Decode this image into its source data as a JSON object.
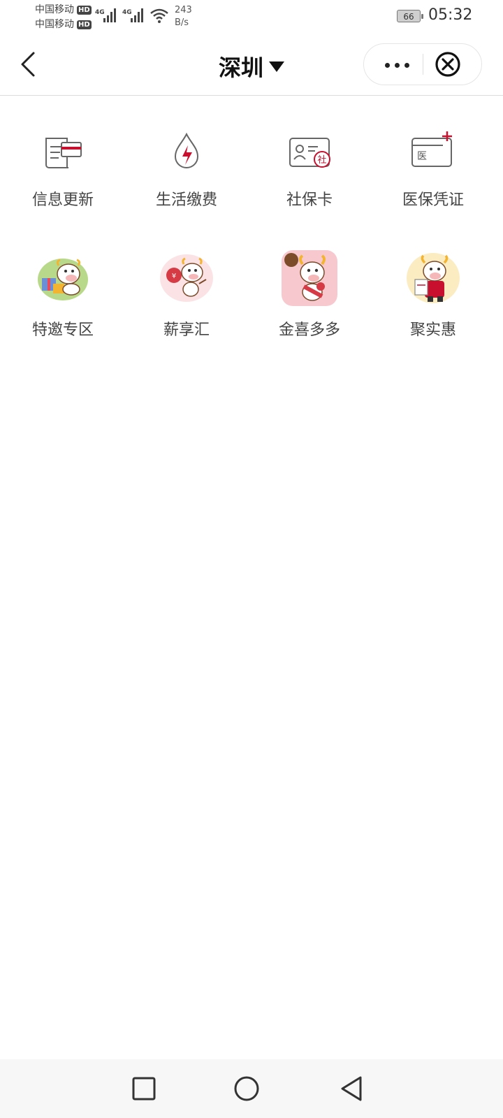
{
  "status": {
    "carrier1": "中国移动",
    "carrier2": "中国移动",
    "hd": "HD",
    "net1": "4G",
    "net2": "4G",
    "speed_value": "243",
    "speed_unit": "B/s",
    "battery": "66",
    "time": "05:32"
  },
  "nav": {
    "city": "深圳"
  },
  "services": [
    {
      "label": "信息更新",
      "icon": "document-card-icon"
    },
    {
      "label": "生活缴费",
      "icon": "electricity-drop-icon"
    },
    {
      "label": "社保卡",
      "icon": "social-security-card-icon"
    },
    {
      "label": "医保凭证",
      "icon": "medical-insurance-card-icon"
    }
  ],
  "promos": [
    {
      "label": "特邀专区",
      "icon": "cow-gift-mascot-icon"
    },
    {
      "label": "薪享汇",
      "icon": "cow-coin-mascot-icon"
    },
    {
      "label": "金喜多多",
      "icon": "cow-sash-mascot-icon"
    },
    {
      "label": "聚实惠",
      "icon": "cow-clipboard-mascot-icon"
    }
  ],
  "colors": {
    "accent": "#c8102e",
    "icon_gray": "#555555"
  }
}
